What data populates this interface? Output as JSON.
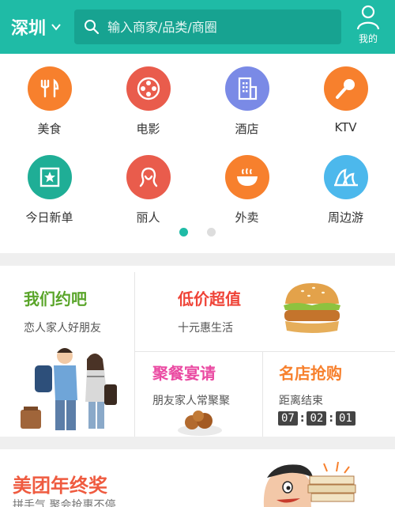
{
  "header": {
    "city": "深圳",
    "search_placeholder": "输入商家/品类/商圈",
    "me_label": "我的"
  },
  "categories": [
    {
      "label": "美食",
      "icon": "fork-knife-icon",
      "color": "#f7802d"
    },
    {
      "label": "电影",
      "icon": "film-reel-icon",
      "color": "#e95c4c"
    },
    {
      "label": "酒店",
      "icon": "building-icon",
      "color": "#7a8ae6"
    },
    {
      "label": "KTV",
      "icon": "microphone-icon",
      "color": "#f7802d"
    },
    {
      "label": "今日新单",
      "icon": "star-square-icon",
      "color": "#1fae96"
    },
    {
      "label": "丽人",
      "icon": "woman-profile-icon",
      "color": "#e95c4c"
    },
    {
      "label": "外卖",
      "icon": "bowl-icon",
      "color": "#f7802d"
    },
    {
      "label": "周边游",
      "icon": "opera-house-icon",
      "color": "#4cb8ec"
    }
  ],
  "pager": {
    "pages": 2,
    "active": 1
  },
  "promos": {
    "date": {
      "title": "我们约吧",
      "subtitle": "恋人家人好朋友",
      "title_color": "#5aa52a"
    },
    "cheap": {
      "title": "低价超值",
      "subtitle": "十元惠生活",
      "title_color": "#ef4438"
    },
    "party": {
      "title": "聚餐宴请",
      "subtitle": "朋友家人常聚聚",
      "title_color": "#ea4aa2"
    },
    "famous": {
      "title": "名店抢购",
      "subtitle": "距离结束",
      "title_color": "#f7802d",
      "timer": {
        "h": "07",
        "m": "02",
        "s": "01"
      }
    }
  },
  "banner": {
    "title": "美团年终奖",
    "subtitle": "拼手气 聚会抢惠不停"
  }
}
